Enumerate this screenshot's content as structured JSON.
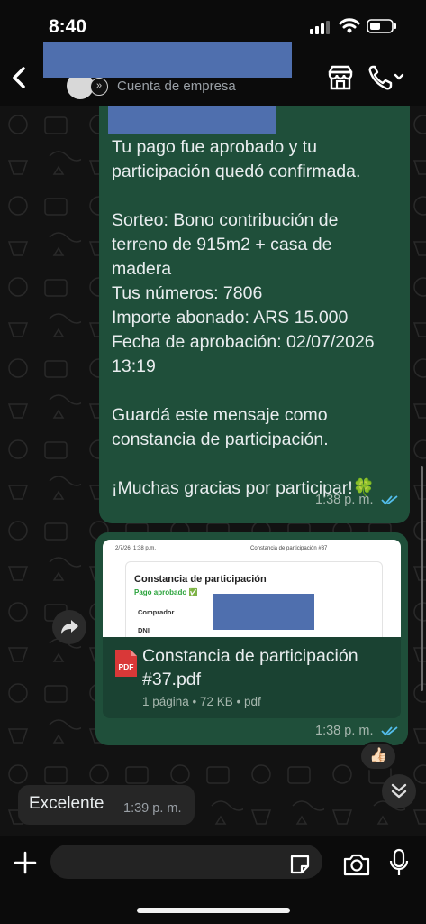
{
  "status_bar": {
    "time": "8:40"
  },
  "header": {
    "business_label": "Cuenta de empresa"
  },
  "messages": {
    "confirmation": {
      "text": "Tu pago fue aprobado y tu\nparticipación quedó confirmada.\n\nSorteo: Bono contribución de\nterreno de 915m2 + casa de\nmadera\nTus números: 7806\nImporte abonado: ARS 15.000\nFecha de aprobación: 02/07/2026\n13:19\n\nGuardá este mensaje como\nconstancia de participación.\n\n¡Muchas gracias por participar!🍀",
      "time": "1:38 p. m."
    },
    "document": {
      "preview_header_left": "2/7/26, 1:38 p.m.",
      "preview_header_center": "Constancia de participación #37",
      "preview_title": "Constancia de participación",
      "preview_status": "Pago aprobado ✅",
      "preview_label_buyer": "Comprador",
      "preview_label_id": "DNI",
      "file_name": "Constancia de participación #37.pdf",
      "file_info": "1 página • 72 KB • pdf",
      "pdf_badge": "PDF",
      "time": "1:38 p. m.",
      "reaction": "👍🏻"
    },
    "reply": {
      "text": "Excelente",
      "time": "1:39 p. m."
    }
  },
  "colors": {
    "outgoing_bubble": "#1f4f3a",
    "incoming_bubble": "#262626",
    "read_ticks": "#53bdeb",
    "redaction": "#4f6fae"
  },
  "icons": [
    "back-icon",
    "store-icon",
    "call-icon",
    "chevron-down-icon",
    "forward-icon",
    "scroll-down-icon",
    "plus-icon",
    "sticker-icon",
    "camera-icon",
    "mic-icon",
    "pdf-icon"
  ]
}
